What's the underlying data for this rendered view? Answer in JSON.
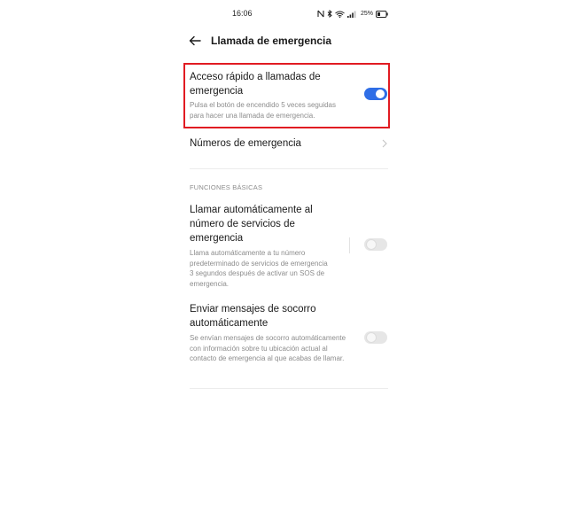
{
  "status_bar": {
    "time": "16:06",
    "battery_percent": "25%",
    "icons": [
      "nfc-icon",
      "bluetooth-icon",
      "wifi-icon",
      "signal-icon",
      "battery-icon"
    ]
  },
  "header": {
    "back_icon": "arrow-left-icon",
    "title": "Llamada de emergencia"
  },
  "quick_access": {
    "title": "Acceso rápido a llamadas de emergencia",
    "description": "Pulsa el botón de encendido 5 veces seguidas para hacer una llamada de emergencia.",
    "enabled": true
  },
  "emergency_numbers": {
    "title": "Números de emergencia"
  },
  "section_basic": {
    "header": "FUNCIONES BÁSICAS"
  },
  "auto_call": {
    "title": "Llamar automáticamente al número de servicios de emergencia",
    "description": "Llama automáticamente a tu número predeterminado de servicios de emergencia 3 segundos después de activar un SOS de emergencia.",
    "enabled": false
  },
  "auto_sms": {
    "title": "Enviar mensajes de socorro automáticamente",
    "description": "Se envían mensajes de socorro automáticamente con información sobre tu ubicación actual al contacto de emergencia al que acabas de llamar.",
    "enabled": false
  },
  "colors": {
    "accent": "#2f6ee6",
    "highlight": "#e11b22",
    "secondary_text": "#8c8c8c"
  }
}
